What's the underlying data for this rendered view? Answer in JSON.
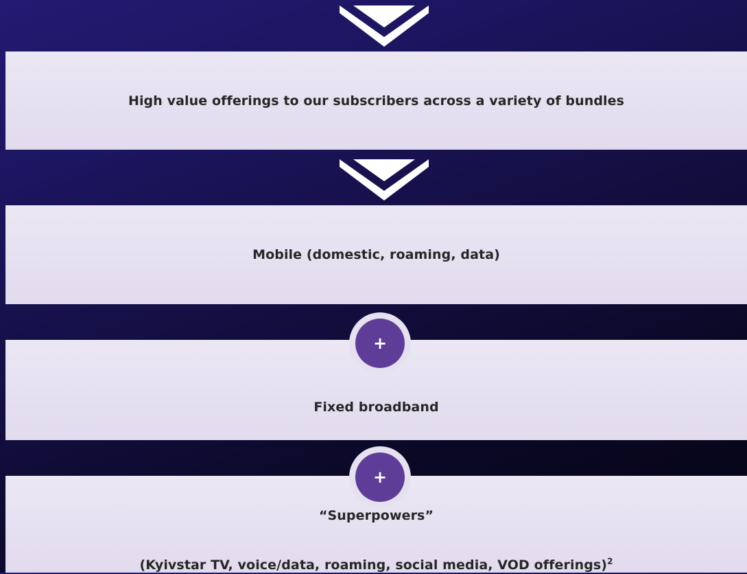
{
  "colors": {
    "background_dark": "#1c1560",
    "band": "#e6e1f0",
    "badge": "#5e3d98",
    "text": "#262626"
  },
  "diagram": {
    "connector_icons": [
      "chevron-down-icon",
      "chevron-down-icon",
      "plus-icon",
      "plus-icon"
    ],
    "bands": [
      {
        "text": "High value offerings to our subscribers across a variety of bundles"
      },
      {
        "text": "Mobile (domestic, roaming, data)"
      },
      {
        "text": "Fixed broadband",
        "badge": "+"
      },
      {
        "line1": "“Superpowers”",
        "line2": "(Kyivstar TV, voice/data, roaming, social media, VOD offerings)",
        "footnote": "2",
        "badge": "+"
      }
    ]
  }
}
